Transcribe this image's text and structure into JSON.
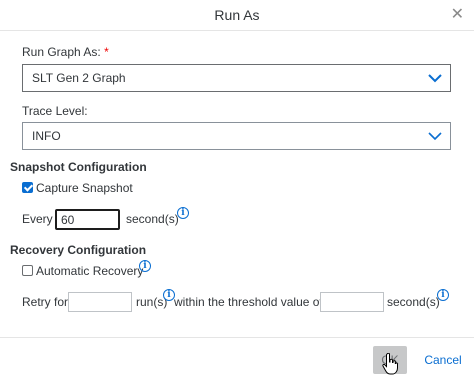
{
  "dialog": {
    "title": "Run As",
    "close_icon": "close-icon"
  },
  "run_graph": {
    "label": "Run Graph As:",
    "required_mark": "*",
    "value": "SLT Gen 2 Graph"
  },
  "trace": {
    "label": "Trace Level:",
    "value": "INFO"
  },
  "snapshot": {
    "section_title": "Snapshot Configuration",
    "checkbox_label": "Capture Snapshot",
    "checked": true,
    "every_label": "Every",
    "every_value": "60",
    "unit_label": "second(s)"
  },
  "recovery": {
    "section_title": "Recovery Configuration",
    "checkbox_label": "Automatic Recovery",
    "checked": false,
    "retry_label": "Retry for",
    "runs_label": "run(s)",
    "threshold_label": "within the threshold value of",
    "unit_label": "second(s)",
    "retry_value": "",
    "threshold_value": ""
  },
  "footer": {
    "ok_label": "OK",
    "cancel_label": "Cancel"
  },
  "colors": {
    "accent": "#0a6ed1",
    "text": "#32363a",
    "required": "#ee0000"
  }
}
